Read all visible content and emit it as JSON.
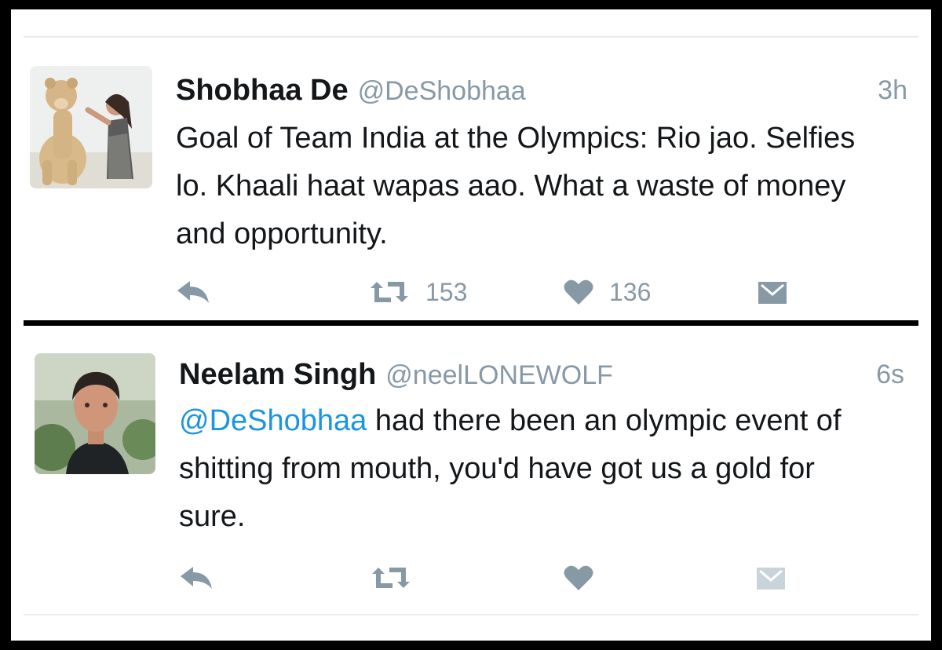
{
  "colors": {
    "border": "#000000",
    "background": "#ffffff",
    "text": "#14171a",
    "muted": "#8899a6",
    "link": "#1b95e0",
    "divider": "#e6ecf0"
  },
  "tweets": [
    {
      "name": "Shobhaa De",
      "handle": "@DeShobhaa",
      "time": "3h",
      "mention": "",
      "text": "Goal of Team India at the Olympics: Rio jao. Selfies lo. Khaali haat wapas aao. What a waste of money and opportunity.",
      "retweet_count": "153",
      "like_count": "136",
      "avatar": "avatar-woman-with-lion-cub",
      "icons": [
        "reply-icon",
        "retweet-icon",
        "heart-icon",
        "direct-message-icon"
      ]
    },
    {
      "name": "Neelam Singh",
      "handle": "@neelLONEWOLF",
      "time": "6s",
      "mention": "@DeShobhaa",
      "text": "had there been an olympic event of shitting from mouth, you'd have got us a gold for sure.",
      "retweet_count": "",
      "like_count": "",
      "avatar": "avatar-man-portrait",
      "icons": [
        "reply-icon",
        "retweet-icon",
        "heart-icon",
        "direct-message-icon"
      ]
    }
  ]
}
